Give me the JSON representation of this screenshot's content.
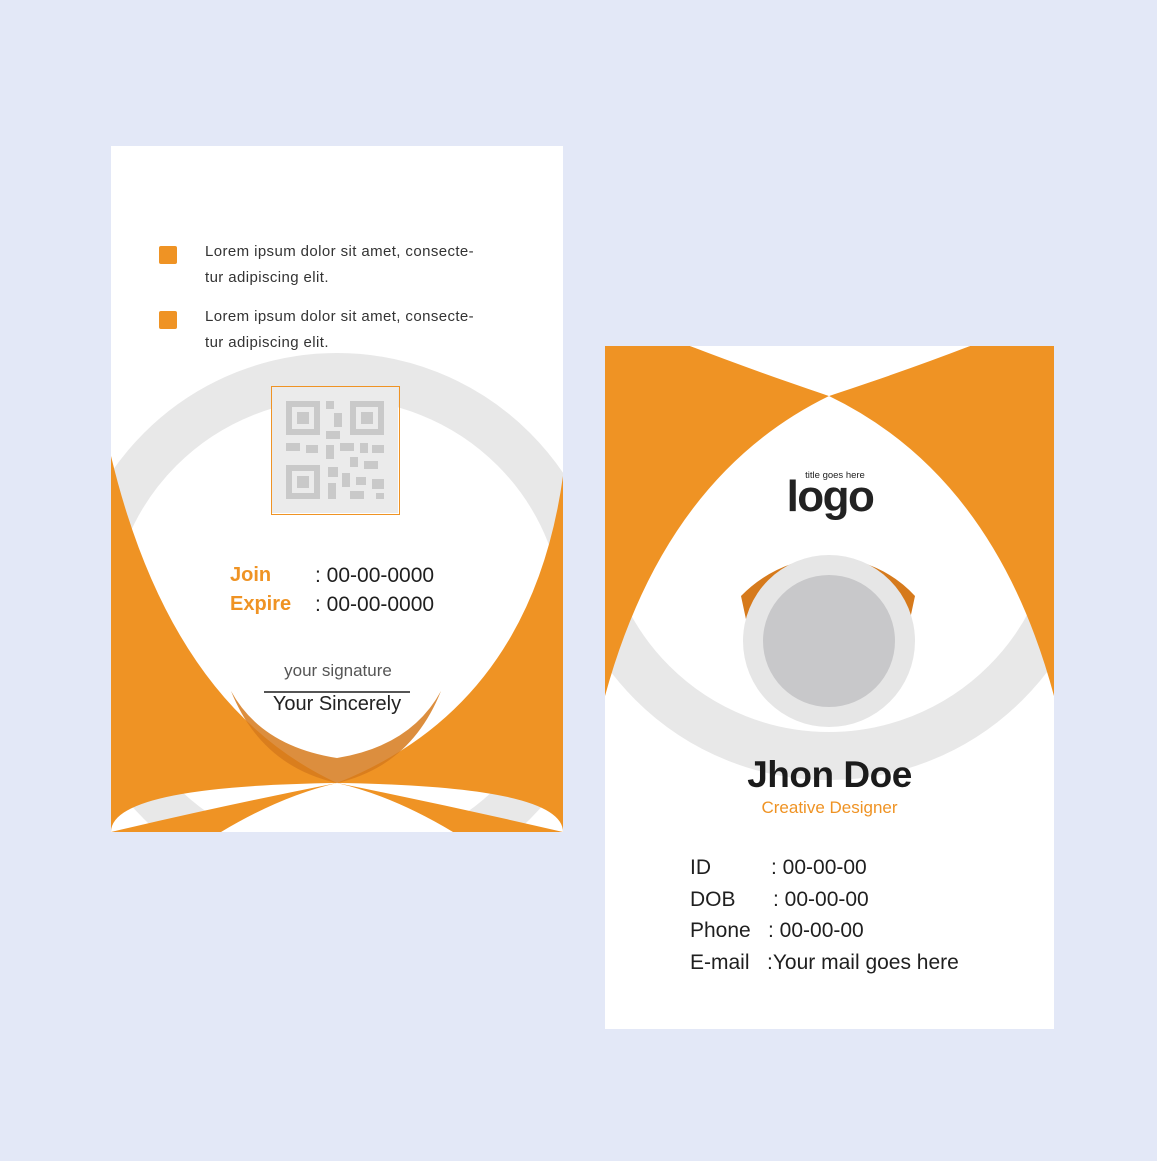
{
  "colors": {
    "accent": "#ef9324",
    "accent_dark": "#d67a1c",
    "ring": "#e8e8e8",
    "photo": "#c8c8ca",
    "background": "#e3e8f7"
  },
  "back_card": {
    "bullets": [
      {
        "line1": "Lorem ipsum dolor sit amet, consecte-",
        "line2": "tur adipiscing elit."
      },
      {
        "line1": "Lorem ipsum dolor sit amet, consecte-",
        "line2": "tur adipiscing elit."
      }
    ],
    "join_label": "Join",
    "join_value": ": 00-00-0000",
    "expire_label": "Expire",
    "expire_value": ": 00-00-0000",
    "signature_hint": "your signature",
    "signature_name": "Your Sincerely"
  },
  "front_card": {
    "logo_tagline": "title goes here",
    "logo_text": "logo",
    "name": "Jhon Doe",
    "role": "Creative Designer",
    "fields": [
      {
        "label": "ID",
        "value": ": 00-00-00"
      },
      {
        "label": "DOB",
        "value": ": 00-00-00"
      },
      {
        "label": "Phone",
        "value": ": 00-00-00"
      },
      {
        "label": "E-mail",
        "value": ":Your mail goes here"
      }
    ]
  }
}
